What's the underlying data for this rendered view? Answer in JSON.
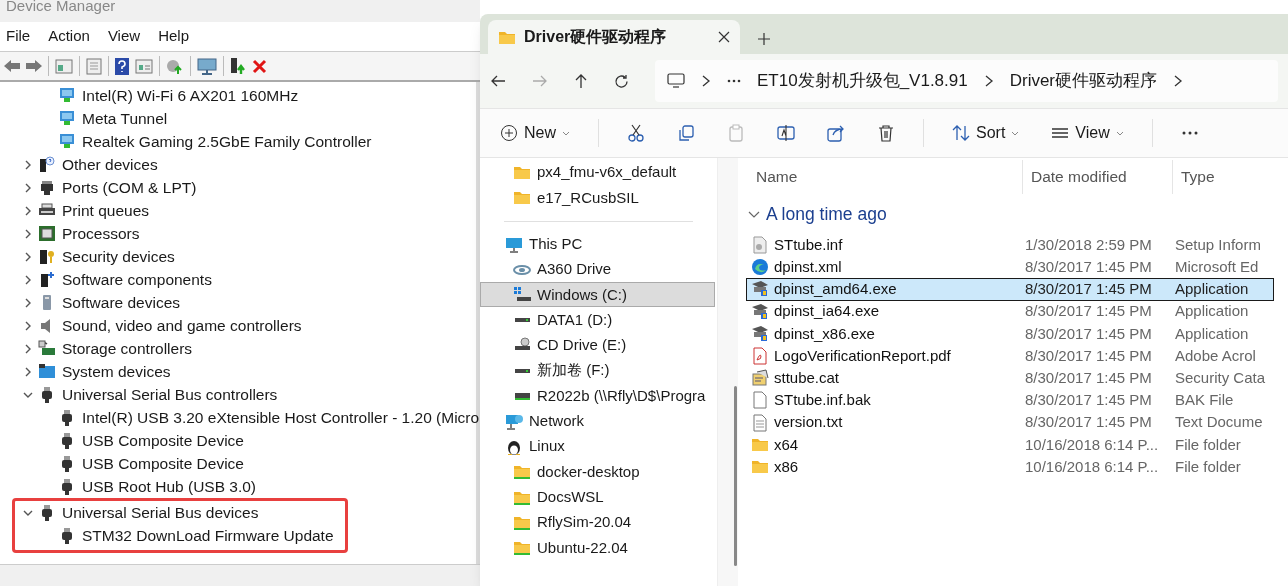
{
  "device_manager": {
    "title": "Device Manager",
    "menu": [
      "File",
      "Action",
      "View",
      "Help"
    ],
    "tree": [
      {
        "children": [
          {
            "label": "Intel(R) Wi-Fi 6 AX201 160MHz",
            "kind": "network"
          },
          {
            "label": "Meta Tunnel",
            "kind": "network"
          },
          {
            "label": "Realtek Gaming 2.5GbE Family Controller",
            "kind": "network"
          }
        ]
      },
      {
        "label": "Other devices",
        "kind": "other",
        "expanded": false
      },
      {
        "label": "Ports (COM & LPT)",
        "kind": "port",
        "expanded": false
      },
      {
        "label": "Print queues",
        "kind": "printer",
        "expanded": false
      },
      {
        "label": "Processors",
        "kind": "chip",
        "expanded": false
      },
      {
        "label": "Security devices",
        "kind": "security",
        "expanded": false
      },
      {
        "label": "Software components",
        "kind": "component",
        "expanded": false
      },
      {
        "label": "Software devices",
        "kind": "softdev",
        "expanded": false
      },
      {
        "label": "Sound, video and game controllers",
        "kind": "sound",
        "expanded": false
      },
      {
        "label": "Storage controllers",
        "kind": "storage",
        "expanded": false
      },
      {
        "label": "System devices",
        "kind": "system",
        "expanded": false
      },
      {
        "label": "Universal Serial Bus controllers",
        "kind": "usb",
        "expanded": true,
        "children": [
          {
            "label": "Intel(R) USB 3.20 eXtensible Host Controller - 1.20 (Micro",
            "kind": "usb"
          },
          {
            "label": "USB Composite Device",
            "kind": "usb"
          },
          {
            "label": "USB Composite Device",
            "kind": "usb"
          },
          {
            "label": "USB Root Hub (USB 3.0)",
            "kind": "usb"
          }
        ]
      },
      {
        "label": "Universal Serial Bus devices",
        "kind": "usb",
        "expanded": true,
        "highlighted": true,
        "children": [
          {
            "label": "STM32 DownLoad Firmware Update",
            "kind": "usb"
          }
        ]
      }
    ]
  },
  "explorer": {
    "tab": {
      "title": "Driver硬件驱动程序",
      "selected": true
    },
    "breadcrumb": [
      "ET10发射机升级包_V1.8.91",
      "Driver硬件驱动程序"
    ],
    "commands": {
      "new": "New",
      "sort": "Sort",
      "view": "View"
    },
    "nav": [
      {
        "children": [
          {
            "label": "px4_fmu-v6x_default",
            "kind": "folder",
            "selected": false
          },
          {
            "label": "e17_RCusbSIL",
            "kind": "folder",
            "selected": false
          }
        ]
      },
      {
        "label": "This PC",
        "kind": "pc",
        "selected": false,
        "children": [
          {
            "label": "A360 Drive",
            "kind": "cloud",
            "selected": false
          },
          {
            "label": "Windows (C:)",
            "kind": "windrive",
            "selected": true
          },
          {
            "label": "DATA1 (D:)",
            "kind": "drive",
            "selected": false
          },
          {
            "label": "CD Drive (E:)",
            "kind": "cd",
            "selected": false
          },
          {
            "label": "新加卷 (F:)",
            "kind": "drive",
            "selected": false
          },
          {
            "label": "R2022b (\\\\Rfly\\D$\\Progra",
            "kind": "netdrive",
            "selected": false
          }
        ]
      },
      {
        "label": "Network",
        "kind": "network",
        "selected": false
      },
      {
        "label": "Linux",
        "kind": "linux",
        "selected": false,
        "children": [
          {
            "label": "docker-desktop",
            "kind": "linuxfolder",
            "selected": false
          },
          {
            "label": "DocsWSL",
            "kind": "linuxfolder",
            "selected": false
          },
          {
            "label": "RflySim-20.04",
            "kind": "linuxfolder",
            "selected": false
          },
          {
            "label": "Ubuntu-22.04",
            "kind": "linuxfolder",
            "selected": false
          }
        ]
      }
    ],
    "columns": [
      "Name",
      "Date modified",
      "Type"
    ],
    "group": "A long time ago",
    "files": [
      {
        "name": "STtube.inf",
        "date": "1/30/2018 2:59 PM",
        "type": "Setup Inform",
        "kind": "inf",
        "selected": false
      },
      {
        "name": "dpinst.xml",
        "date": "8/30/2017 1:45 PM",
        "type": "Microsoft Ed",
        "kind": "edge",
        "selected": false
      },
      {
        "name": "dpinst_amd64.exe",
        "date": "8/30/2017 1:45 PM",
        "type": "Application",
        "kind": "exe",
        "selected": true
      },
      {
        "name": "dpinst_ia64.exe",
        "date": "8/30/2017 1:45 PM",
        "type": "Application",
        "kind": "exe",
        "selected": false
      },
      {
        "name": "dpinst_x86.exe",
        "date": "8/30/2017 1:45 PM",
        "type": "Application",
        "kind": "exe",
        "selected": false
      },
      {
        "name": "LogoVerificationReport.pdf",
        "date": "8/30/2017 1:45 PM",
        "type": "Adobe Acrol",
        "kind": "pdf",
        "selected": false
      },
      {
        "name": "sttube.cat",
        "date": "8/30/2017 1:45 PM",
        "type": "Security Cata",
        "kind": "cat",
        "selected": false
      },
      {
        "name": "STtube.inf.bak",
        "date": "8/30/2017 1:45 PM",
        "type": "BAK File",
        "kind": "blank",
        "selected": false
      },
      {
        "name": "version.txt",
        "date": "8/30/2017 1:45 PM",
        "type": "Text Docume",
        "kind": "txt",
        "selected": false
      },
      {
        "name": "x64",
        "date": "10/16/2018 6:14 P...",
        "type": "File folder",
        "kind": "folder",
        "selected": false
      },
      {
        "name": "x86",
        "date": "10/16/2018 6:14 P...",
        "type": "File folder",
        "kind": "folder",
        "selected": false
      }
    ]
  }
}
